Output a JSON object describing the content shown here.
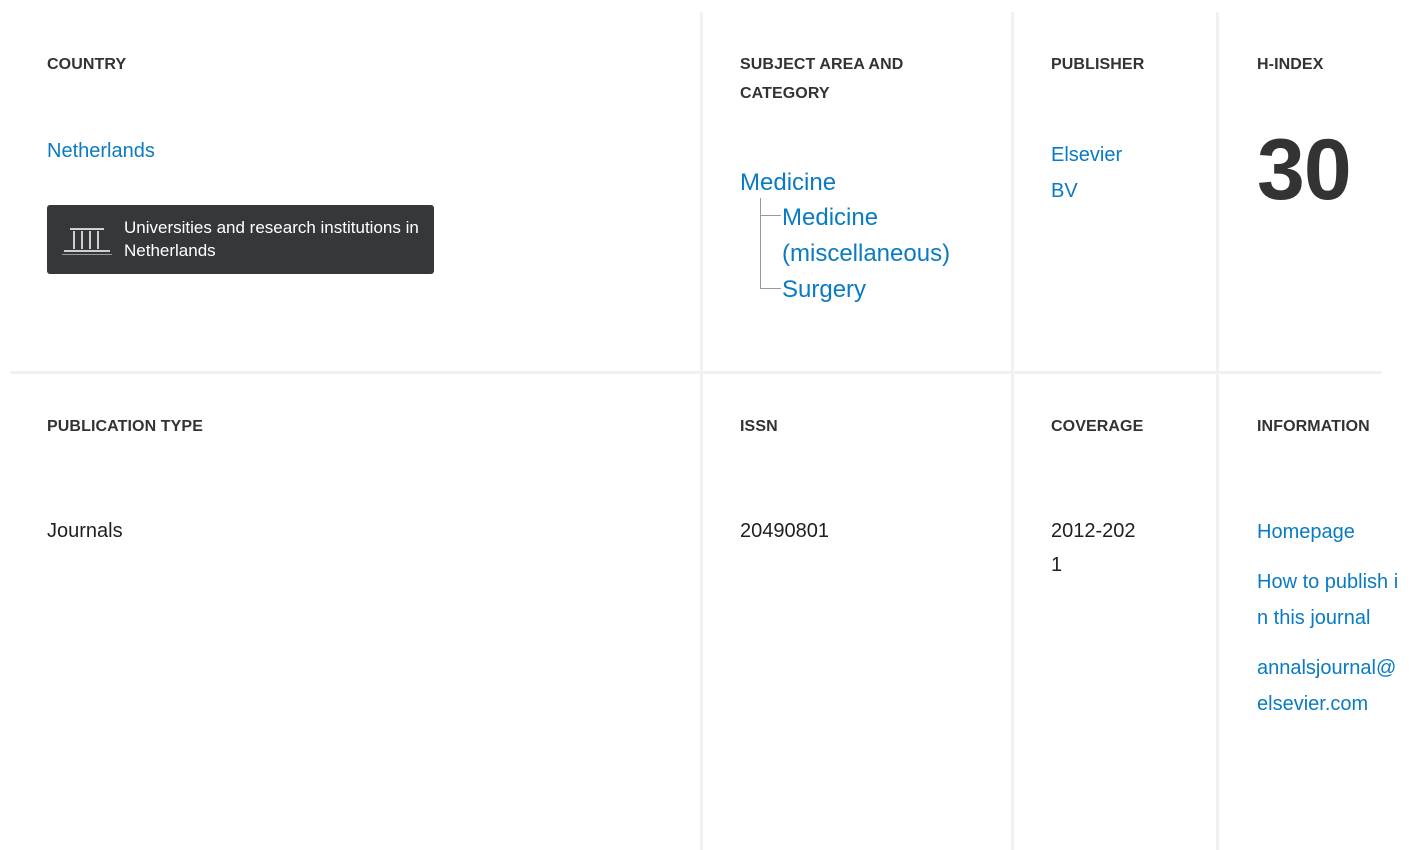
{
  "country": {
    "heading": "COUNTRY",
    "value": "Netherlands",
    "institutions_button": "Universities and research institutions in Netherlands",
    "institutions_icon": "institution-columns-icon"
  },
  "subject": {
    "heading": "SUBJECT AREA AND CATEGORY",
    "area": "Medicine",
    "categories": [
      "Medicine (miscellaneous)",
      "Surgery"
    ]
  },
  "publisher": {
    "heading": "PUBLISHER",
    "value": "Elsevier BV"
  },
  "hindex": {
    "heading": "H-INDEX",
    "value": "30"
  },
  "publication_type": {
    "heading": "PUBLICATION TYPE",
    "value": "Journals"
  },
  "issn": {
    "heading": "ISSN",
    "value": "20490801"
  },
  "coverage": {
    "heading": "COVERAGE",
    "value": "2012-2021"
  },
  "information": {
    "heading": "INFORMATION",
    "links": [
      "Homepage",
      "How to publish in this journal",
      "annalsjournal@elsevier.com"
    ]
  },
  "colors": {
    "link": "#0a7bc2",
    "heading": "#333333",
    "button_bg": "#353839",
    "divider": "#f1f1f1"
  }
}
